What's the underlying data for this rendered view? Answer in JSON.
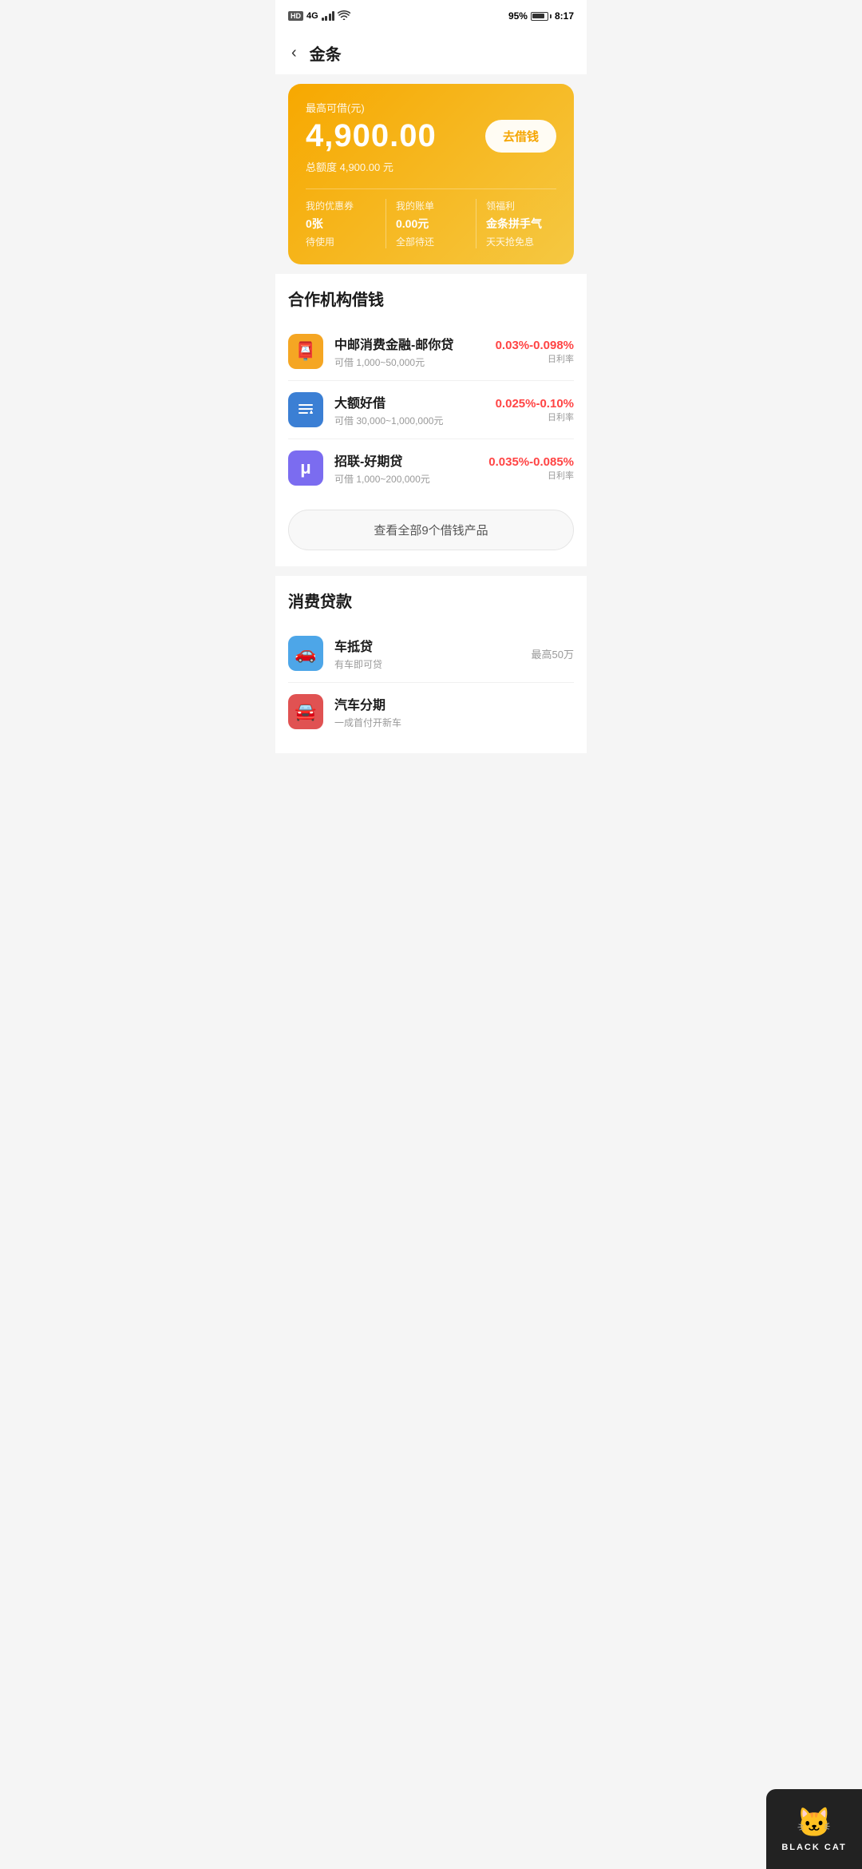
{
  "statusBar": {
    "hd": "HD",
    "signal": "4G",
    "battery": "95%",
    "time": "8:17"
  },
  "header": {
    "backIcon": "‹",
    "title": "金条"
  },
  "yellowCard": {
    "subtitle": "最高可借(元)",
    "amount": "4,900.00",
    "borrowBtn": "去借钱",
    "totalLabel": "总额度 4,900.00 元",
    "menu": [
      {
        "label": "我的优惠券",
        "value": "0张",
        "sub": "待使用"
      },
      {
        "label": "我的账单",
        "value": "0.00元",
        "sub": "全部待还"
      },
      {
        "label": "领福利",
        "value": "金条拼手气",
        "sub": "天天抢免息"
      }
    ]
  },
  "cooperationSection": {
    "title": "合作机构借钱",
    "items": [
      {
        "name": "中邮消费金融-邮你贷",
        "desc": "可借 1,000~50,000元",
        "rate": "0.03%-0.098%",
        "rateLabel": "日利率",
        "iconColor": "orange",
        "iconText": "📮"
      },
      {
        "name": "大额好借",
        "desc": "可借 30,000~1,000,000元",
        "rate": "0.025%-0.10%",
        "rateLabel": "日利率",
        "iconColor": "blue",
        "iconText": "📋"
      },
      {
        "name": "招联-好期贷",
        "desc": "可借 1,000~200,000元",
        "rate": "0.035%-0.085%",
        "rateLabel": "日利率",
        "iconColor": "purple",
        "iconText": "μ"
      }
    ],
    "viewAllBtn": "查看全部9个借钱产品"
  },
  "consumerSection": {
    "title": "消费贷款",
    "items": [
      {
        "name": "车抵贷",
        "desc": "有车即可贷",
        "max": "最高50万",
        "iconColor": "sky",
        "iconText": "🚗"
      },
      {
        "name": "汽车分期",
        "desc": "一成首付开新车",
        "max": "",
        "iconColor": "red",
        "iconText": "🚘"
      }
    ]
  },
  "watermark": {
    "catEmoji": "🐱",
    "text": "BLACK CAT"
  }
}
